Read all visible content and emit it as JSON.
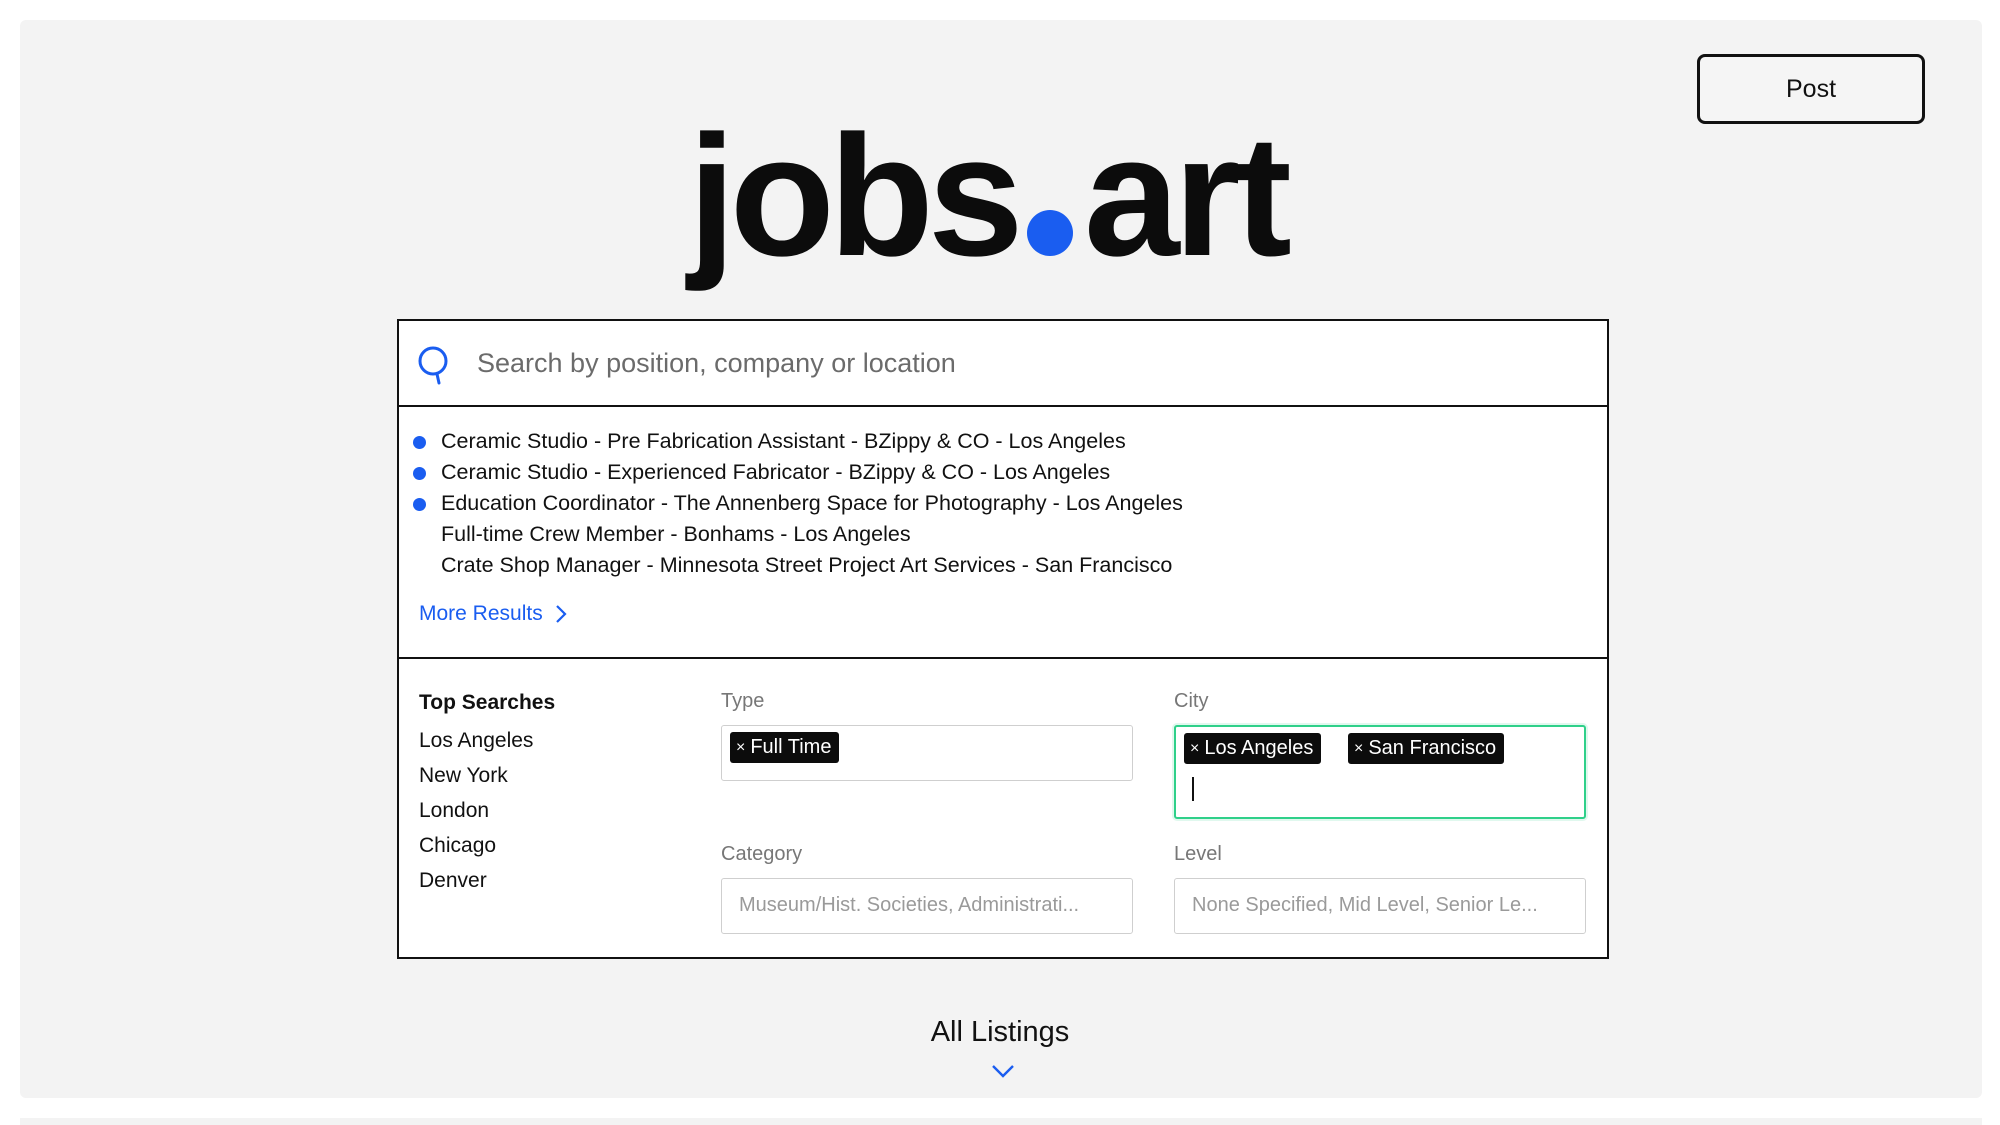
{
  "header": {
    "post_label": "Post"
  },
  "logo": {
    "left_text": "jobs",
    "right_text": "art",
    "dot_color": "#1a5df0"
  },
  "search": {
    "placeholder": "Search by position, company or location",
    "icon": "search-icon"
  },
  "results": [
    {
      "text": "Ceramic Studio - Pre Fabrication Assistant - BZippy & CO - Los Angeles",
      "new": true
    },
    {
      "text": "Ceramic Studio - Experienced Fabricator - BZippy & CO - Los Angeles",
      "new": true
    },
    {
      "text": "Education Coordinator - The Annenberg Space for Photography - Los Angeles",
      "new": true
    },
    {
      "text": "Full-time Crew Member - Bonhams - Los Angeles",
      "new": false
    },
    {
      "text": "Crate Shop Manager - Minnesota Street Project Art Services - San Francisco",
      "new": false
    }
  ],
  "more_results_label": "More Results",
  "top_searches": {
    "title": "Top Searches",
    "items": [
      "Los Angeles",
      "New York",
      "London",
      "Chicago",
      "Denver"
    ]
  },
  "filters": {
    "type": {
      "label": "Type",
      "tags": [
        "Full Time"
      ]
    },
    "city": {
      "label": "City",
      "tags": [
        "Los Angeles",
        "San Francisco"
      ]
    },
    "category": {
      "label": "Category",
      "placeholder": "Museum/Hist. Societies, Administrati..."
    },
    "level": {
      "label": "Level",
      "placeholder": "None Specified, Mid Level, Senior Le..."
    }
  },
  "tag_remove_glyph": "×",
  "all_listings_label": "All Listings",
  "colors": {
    "accent": "#1a5df0",
    "focus": "#2fd08a",
    "panel": "#f3f3f3"
  }
}
